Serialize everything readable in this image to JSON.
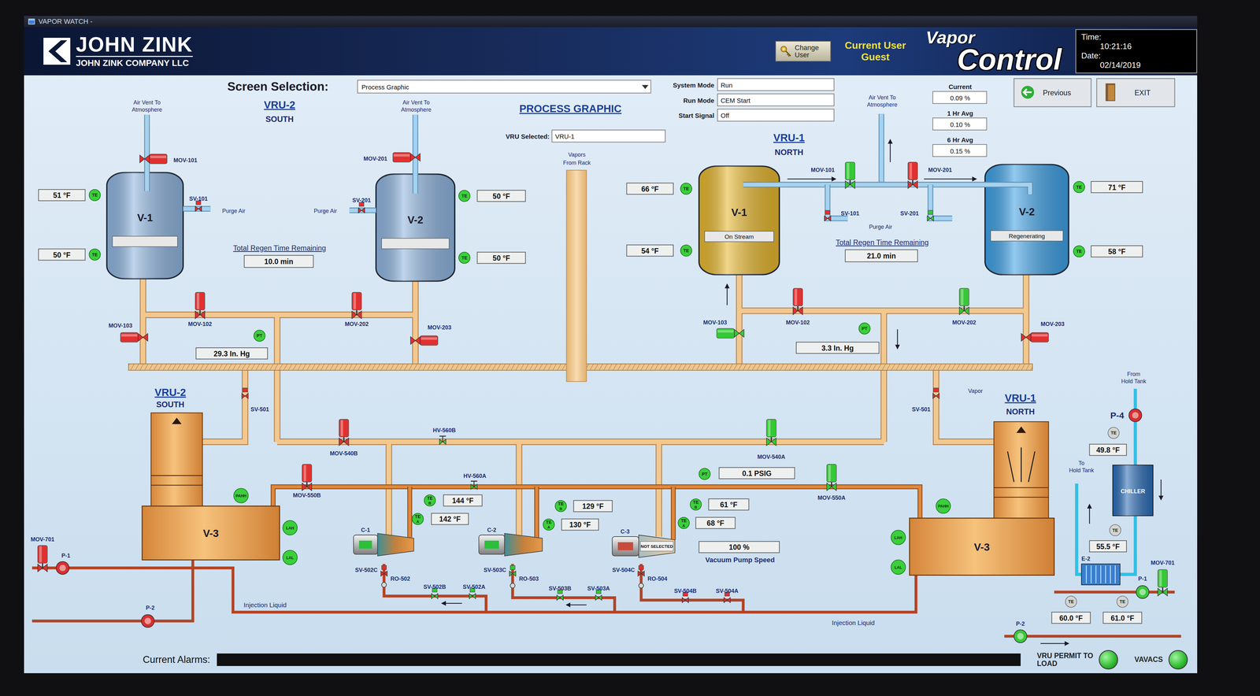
{
  "window": {
    "title": "VAPOR WATCH -"
  },
  "header": {
    "logo": "JOHN ZINK",
    "company": "JOHN ZINK COMPANY LLC",
    "change_user": "Change User",
    "user_label": "Current User",
    "user": "Guest",
    "title_small": "Vapor",
    "title_big": "Control",
    "time_label": "Time:",
    "time": "10:21:16",
    "date_label": "Date:",
    "date": "02/14/2019"
  },
  "toolbar": {
    "screen_label": "Screen Selection:",
    "screen": "Process Graphic",
    "page_title": "PROCESS GRAPHIC",
    "vru_label": "VRU Selected:",
    "vru": "VRU-1",
    "modes": [
      {
        "label": "System Mode",
        "value": "Run"
      },
      {
        "label": "Run Mode",
        "value": "CEM Start"
      },
      {
        "label": "Start Signal",
        "value": "Off"
      }
    ],
    "readings": [
      {
        "label": "Current",
        "value": "0.09 %"
      },
      {
        "label": "1 Hr Avg",
        "value": "0.10 %"
      },
      {
        "label": "6 Hr Avg",
        "value": "0.15 %"
      }
    ],
    "buttons": [
      {
        "label": "Previous"
      },
      {
        "label": "EXIT"
      }
    ]
  },
  "labels": [
    "VRU-2",
    "SOUTH",
    "VRU-1",
    "NORTH",
    "VRU-2",
    "SOUTH",
    "VRU-1",
    "NORTH",
    "Air Vent To",
    "Atmosphere",
    "Air Vent To",
    "Atmosphere",
    "Air Vent To",
    "Atmosphere",
    "Vapors",
    "From Rack",
    "Purge Air",
    "Purge Air",
    "Purge Air",
    "Injection Liquid",
    "Injection Liquid",
    "Vapor",
    "From",
    "Hold Tank",
    "To",
    "Hold Tank"
  ],
  "vessels": [
    {
      "label": "V-1",
      "status": "",
      "color": "#8db3dd"
    },
    {
      "label": "V-2",
      "status": "",
      "color": "#8db3dd"
    },
    {
      "label": "V-1",
      "status": "On Stream",
      "color": "#e5b52c"
    },
    {
      "label": "V-2",
      "status": "Regenerating",
      "color": "#3d9fe3"
    }
  ],
  "regen": [
    {
      "label": "Total Regen Time Remaining",
      "value": "10.0 min"
    },
    {
      "label": "Total Regen Time Remaining",
      "value": "21.0 min"
    }
  ],
  "valves": [
    {
      "label": "MOV-101",
      "open": false
    },
    {
      "label": "SV-101",
      "open": false
    },
    {
      "label": "MOV-201",
      "open": false
    },
    {
      "label": "SV-201",
      "open": false
    },
    {
      "label": "MOV-102",
      "open": false
    },
    {
      "label": "MOV-202",
      "open": false
    },
    {
      "label": "MOV-103",
      "open": false
    },
    {
      "label": "MOV-203",
      "open": false
    },
    {
      "label": "MOV-101",
      "open": true
    },
    {
      "label": "MOV-201",
      "open": false
    },
    {
      "label": "SV-101",
      "open": false
    },
    {
      "label": "SV-201",
      "open": true
    },
    {
      "label": "MOV-102",
      "open": false
    },
    {
      "label": "MOV-202",
      "open": true
    },
    {
      "label": "MOV-103",
      "open": true
    },
    {
      "label": "MOV-203",
      "open": false
    },
    {
      "label": "SV-501",
      "open": false
    },
    {
      "label": "SV-501",
      "open": false
    },
    {
      "label": "MOV-540B",
      "open": false
    },
    {
      "label": "HV-560B",
      "open": true
    },
    {
      "label": "MOV-540A",
      "open": true
    },
    {
      "label": "MOV-550B",
      "open": false
    },
    {
      "label": "HV-560A",
      "open": true
    },
    {
      "label": "MOV-550A",
      "open": true
    },
    {
      "label": "SV-502C",
      "open": false
    },
    {
      "label": "SV-502B",
      "open": true
    },
    {
      "label": "SV-502A",
      "open": true
    },
    {
      "label": "SV-503C",
      "open": true
    },
    {
      "label": "SV-503B",
      "open": true
    },
    {
      "label": "SV-503A",
      "open": true
    },
    {
      "label": "SV-504C",
      "open": false
    },
    {
      "label": "SV-504B",
      "open": false
    },
    {
      "label": "SV-504A",
      "open": false
    },
    {
      "label": "MOV-701",
      "open": false
    },
    {
      "label": "MOV-701",
      "open": true
    }
  ],
  "orifices": [
    "RO-502",
    "RO-503",
    "RO-504"
  ],
  "sensors": [
    {
      "tag": "TE",
      "value": "51 °F",
      "active": true
    },
    {
      "tag": "TE",
      "value": "50 °F",
      "active": true
    },
    {
      "tag": "TE",
      "value": "50 °F",
      "active": true
    },
    {
      "tag": "TE",
      "value": "50 °F",
      "active": true
    },
    {
      "tag": "PT",
      "value": "29.3 In. Hg",
      "active": true
    },
    {
      "tag": "TE",
      "value": "66 °F",
      "active": true
    },
    {
      "tag": "TE",
      "value": "54 °F",
      "active": true
    },
    {
      "tag": "TE",
      "value": "71 °F",
      "active": true
    },
    {
      "tag": "TE",
      "value": "58 °F",
      "active": true
    },
    {
      "tag": "PT",
      "value": "3.3 In. Hg",
      "active": true
    },
    {
      "tag": "PT",
      "value": "0.1 PSIG",
      "active": true
    },
    {
      "tag": "TE",
      "sub": "B",
      "value": "144 °F",
      "active": true
    },
    {
      "tag": "TE",
      "sub": "A",
      "value": "142 °F",
      "active": true
    },
    {
      "tag": "TE",
      "sub": "B",
      "value": "129 °F",
      "active": true
    },
    {
      "tag": "TE",
      "sub": "A",
      "value": "130 °F",
      "active": true
    },
    {
      "tag": "TE",
      "sub": "B",
      "value": "61 °F",
      "active": true
    },
    {
      "tag": "TE",
      "sub": "A",
      "value": "68 °F",
      "active": true
    },
    {
      "tag": "PAHH",
      "active": true
    },
    {
      "tag": "LAH",
      "active": true
    },
    {
      "tag": "LAL",
      "active": true
    },
    {
      "tag": "PAHH",
      "active": true
    },
    {
      "tag": "LAH",
      "active": true
    },
    {
      "tag": "LAL",
      "active": true
    },
    {
      "tag": "TE",
      "value": "49.8 °F",
      "active": false
    },
    {
      "tag": "TE",
      "value": "55.5 °F",
      "active": false
    },
    {
      "tag": "TE",
      "value": "60.0 °F",
      "active": false
    },
    {
      "tag": "TE",
      "value": "61.0 °F",
      "active": false
    }
  ],
  "compressors": [
    {
      "label": "C-1",
      "selected": true
    },
    {
      "label": "C-2",
      "selected": true
    },
    {
      "label": "C-3",
      "selected": false,
      "note": "NOT SELECTED"
    }
  ],
  "vacuum_pump": {
    "label": "Vacuum Pump Speed",
    "value": "100 %"
  },
  "tanks": [
    {
      "label": "V-3"
    },
    {
      "label": "V-3"
    }
  ],
  "pumps": [
    {
      "label": "P-1",
      "running": false
    },
    {
      "label": "P-2",
      "running": false
    },
    {
      "label": "P-1",
      "running": true
    },
    {
      "label": "P-2",
      "running": true
    },
    {
      "label": "P-4",
      "running": false
    }
  ],
  "chiller": {
    "label": "CHILLER"
  },
  "exchanger": {
    "label": "E-2"
  },
  "alarms": {
    "label": "Current Alarms:"
  },
  "permits": [
    {
      "label": "VRU PERMIT TO LOAD",
      "on": true
    },
    {
      "label": "VAVACS",
      "on": true
    }
  ]
}
